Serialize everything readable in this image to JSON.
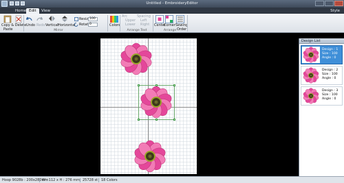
{
  "window": {
    "title": "Untitled - EmbroideryEditor"
  },
  "tabs": [
    {
      "label": "Home",
      "active": false
    },
    {
      "label": "Edit",
      "active": true
    },
    {
      "label": "View",
      "active": false
    }
  ],
  "style_link": "Style",
  "ribbon": {
    "copy_delete": "Copy & Delete",
    "paste": "Paste",
    "undo": "Undo",
    "redo": "Redo",
    "vertical": "Vertical",
    "horizontal": "Horizontal",
    "mirror_group": "Mirror",
    "resize_label": "Resize",
    "resize_value": "100",
    "rotate_label": "Rotate",
    "rotate_value": "0",
    "colors": "Colors",
    "arc": "Arc",
    "upper": "Upper",
    "lower": "Lower",
    "spacing": "Spacing",
    "left": "Left",
    "right": "Right",
    "arrange_text_group": "Arrange Text",
    "center": "Center",
    "corner": "Corner",
    "arrange_group": "Arrange",
    "sewing_order": "Sewing",
    "sewing_order2": "Order"
  },
  "design_list": {
    "title": "Design List",
    "items": [
      {
        "line1": "Design : 1",
        "line2": "Size : 100",
        "line3": "Angle : 0",
        "selected": true
      },
      {
        "line1": "Design : 2",
        "line2": "Size : 100",
        "line3": "Angle : 0",
        "selected": false
      },
      {
        "line1": "Design : 3",
        "line2": "Size : 100",
        "line3": "Angle : 0",
        "selected": false
      }
    ]
  },
  "status": {
    "hoop": "Hoop 9028b : 200x280mm",
    "size": "W : 112 x H : 276 mm",
    "stitches": "25728 st",
    "colors": "18 Colors"
  },
  "colors": {
    "petal": "#e4479a",
    "petal_light": "#f27bb6",
    "center": "#3d3a1a",
    "center_ring": "#9aa62a",
    "accent": "#3f8fd8"
  }
}
